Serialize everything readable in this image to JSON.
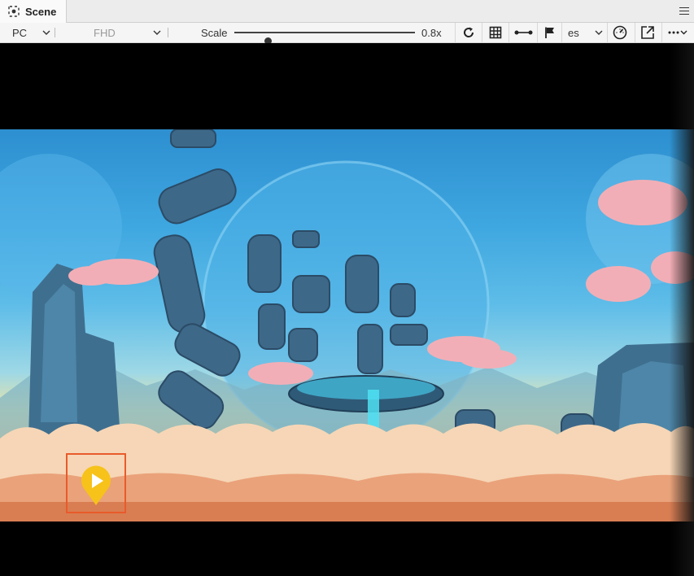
{
  "panel": {
    "tab_title": "Scene",
    "tab_icon": "scene-icon",
    "menu_icon": "hamburger-menu-icon"
  },
  "toolbar": {
    "platform": "PC",
    "resolution": "FHD",
    "scale_label": "Scale",
    "scale_value": "0.8x",
    "scale_fraction": 0.08,
    "language": "es",
    "icons": [
      "refresh-icon",
      "grid-icon",
      "connect-icon",
      "flag-icon",
      "gauge-icon",
      "open-external-icon",
      "more-icon"
    ]
  },
  "colors": {
    "marker_border": "#e85b2b",
    "marker_fill": "#f7c21a",
    "sky_top": "#2d8fd0",
    "cloud": "#f6d6b6"
  }
}
